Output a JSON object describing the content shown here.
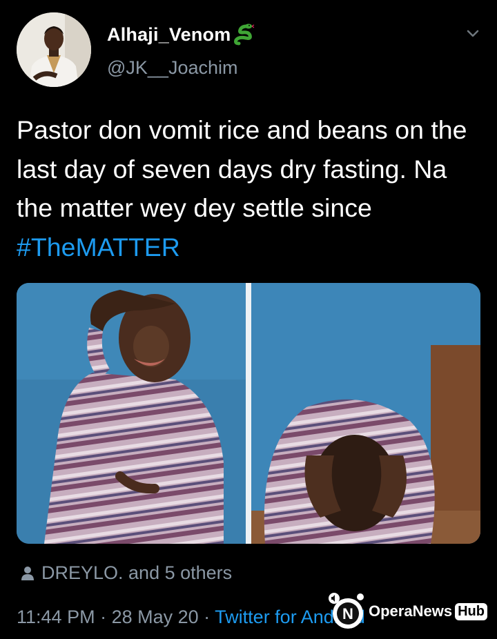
{
  "tweet": {
    "display_name": "Alhaji_Venom",
    "name_emoji": "snake-icon",
    "handle": "@JK__Joachim",
    "text_main": "Pastor don vomit rice and beans on the last day of seven days dry fasting.  Na the matter wey dey settle since ",
    "hashtag": "#TheMATTER",
    "media_image": "crying-boy-meme-image",
    "liked_by": "DREYLO. and 5 others",
    "time": "11:44 PM",
    "separator": " · ",
    "date": "28 May 20",
    "source": "Twitter for Android"
  },
  "watermark": {
    "text": "OperaNews",
    "badge": "Hub"
  },
  "colors": {
    "background": "#000000",
    "text": "#ffffff",
    "secondary": "#8b98a5",
    "accent": "#1d9bf0"
  }
}
